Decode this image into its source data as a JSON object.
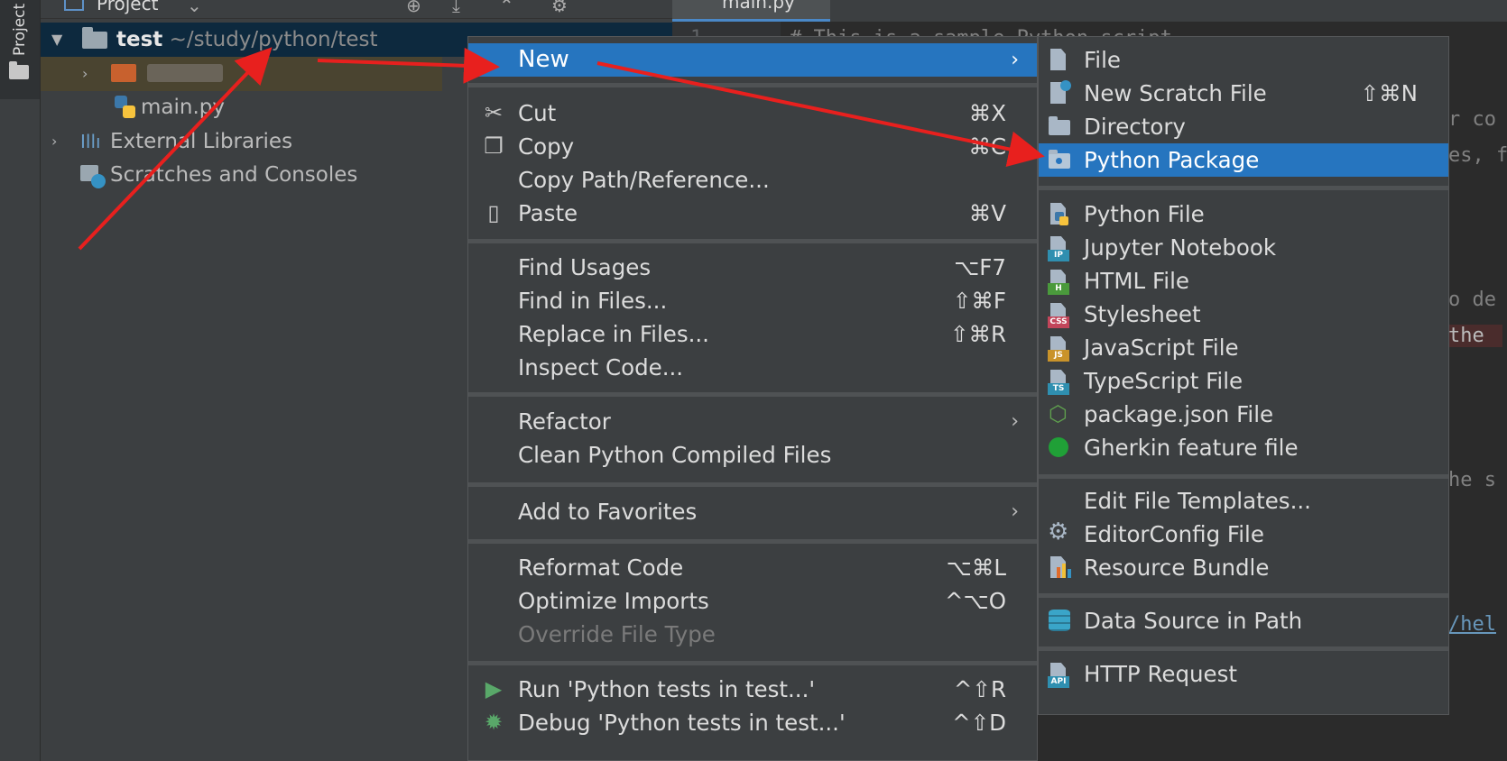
{
  "sidebar": {
    "tool_label": "Project"
  },
  "project_panel": {
    "title": "Project",
    "tree": [
      {
        "label": "test",
        "path": "~/study/python/test",
        "expanded": true
      },
      {
        "label": "",
        "note": "blurred folder"
      },
      {
        "label": "main.py"
      },
      {
        "label": "External Libraries"
      },
      {
        "label": "Scratches and Consoles"
      }
    ]
  },
  "editor": {
    "tab_label": "main.py",
    "line_number": "1",
    "lines": [
      "# This is a sample Python script.",
      "r co",
      "es, f",
      "o de",
      "the",
      "he s",
      "/hel"
    ]
  },
  "context_menu": {
    "items": [
      {
        "label": "New",
        "highlighted": true,
        "submenu": true
      },
      {
        "label": "Cut",
        "shortcut": "⌘X",
        "icon": "scissors-icon"
      },
      {
        "label": "Copy",
        "shortcut": "⌘C",
        "icon": "copy-icon"
      },
      {
        "label": "Copy Path/Reference..."
      },
      {
        "label": "Paste",
        "shortcut": "⌘V",
        "icon": "clipboard-icon"
      },
      {
        "label": "Find Usages",
        "shortcut": "⌥F7"
      },
      {
        "label": "Find in Files...",
        "shortcut": "⇧⌘F"
      },
      {
        "label": "Replace in Files...",
        "shortcut": "⇧⌘R"
      },
      {
        "label": "Inspect Code..."
      },
      {
        "label": "Refactor",
        "submenu": true
      },
      {
        "label": "Clean Python Compiled Files"
      },
      {
        "label": "Add to Favorites",
        "submenu": true
      },
      {
        "label": "Reformat Code",
        "shortcut": "⌥⌘L"
      },
      {
        "label": "Optimize Imports",
        "shortcut": "^⌥O"
      },
      {
        "label": "Override File Type",
        "disabled": true
      },
      {
        "label": "Run 'Python tests in test...'",
        "shortcut": "^⇧R",
        "icon": "run-icon"
      },
      {
        "label": "Debug 'Python tests in test...'",
        "shortcut": "^⇧D",
        "icon": "debug-icon"
      }
    ]
  },
  "new_submenu": {
    "items": [
      {
        "label": "File"
      },
      {
        "label": "New Scratch File",
        "shortcut": "⇧⌘N"
      },
      {
        "label": "Directory"
      },
      {
        "label": "Python Package",
        "highlighted": true
      },
      {
        "label": "Python File"
      },
      {
        "label": "Jupyter Notebook",
        "badge": "IP"
      },
      {
        "label": "HTML File",
        "badge": "H"
      },
      {
        "label": "Stylesheet",
        "badge": "CSS"
      },
      {
        "label": "JavaScript File",
        "badge": "JS"
      },
      {
        "label": "TypeScript File",
        "badge": "TS"
      },
      {
        "label": "package.json File"
      },
      {
        "label": "Gherkin feature file"
      },
      {
        "label": "Edit File Templates..."
      },
      {
        "label": "EditorConfig File"
      },
      {
        "label": "Resource Bundle"
      },
      {
        "label": "Data Source in Path"
      },
      {
        "label": "HTTP Request",
        "badge": "API"
      }
    ]
  },
  "colors": {
    "highlight": "#2675bf",
    "menu_bg": "#3c3f41",
    "annotation": "#e8201e"
  }
}
